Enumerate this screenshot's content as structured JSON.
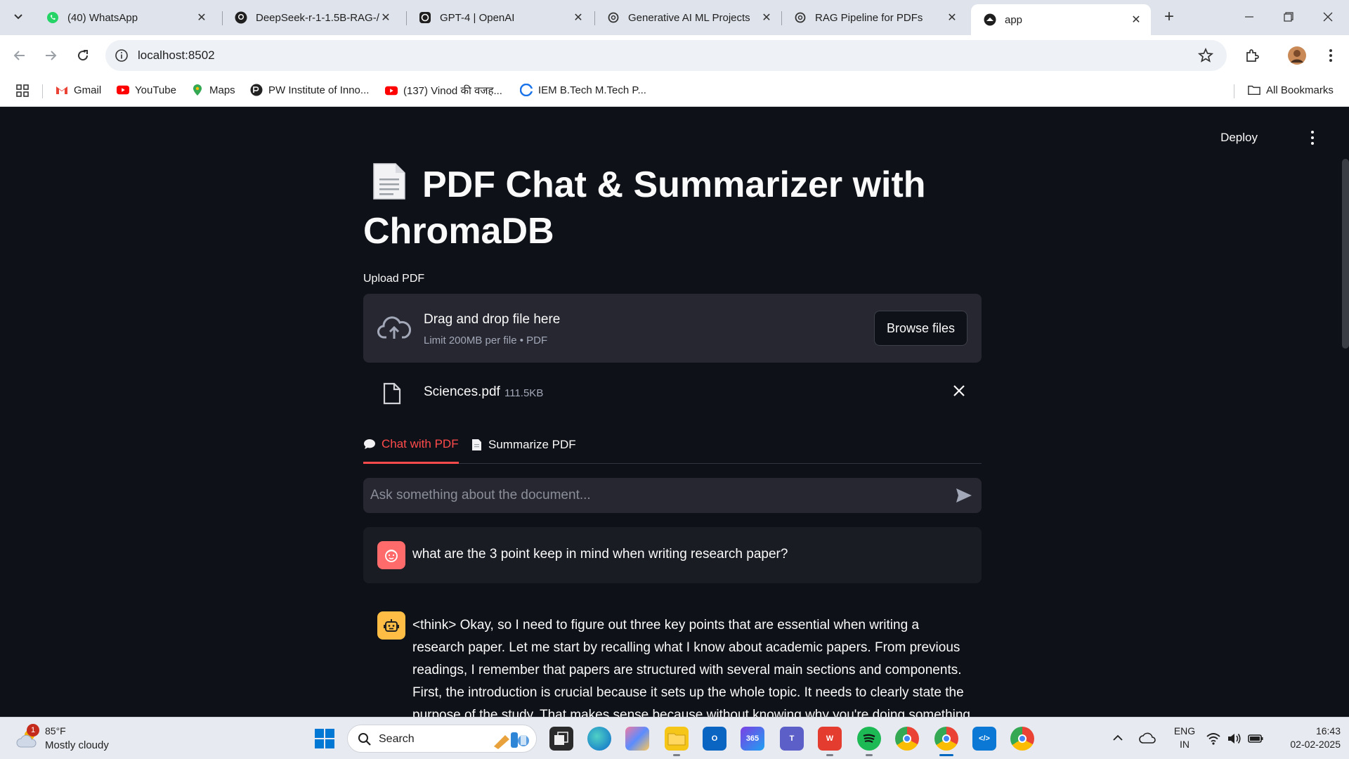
{
  "browser": {
    "tabs": [
      {
        "title": "(40) WhatsApp"
      },
      {
        "title": "DeepSeek-r-1-1.5B-RAG-/"
      },
      {
        "title": "GPT-4 | OpenAI"
      },
      {
        "title": "Generative AI ML Projects"
      },
      {
        "title": "RAG Pipeline for PDFs"
      },
      {
        "title": "app"
      }
    ],
    "url": "localhost:8502",
    "bookmarks": [
      {
        "label": "Gmail"
      },
      {
        "label": "YouTube"
      },
      {
        "label": "Maps"
      },
      {
        "label": "PW Institute of Inno..."
      },
      {
        "label": "(137) Vinod की वजह..."
      },
      {
        "label": "IEM B.Tech M.Tech P..."
      }
    ],
    "all_bookmarks": "All Bookmarks"
  },
  "app": {
    "deploy_label": "Deploy",
    "title": "PDF Chat & Summarizer with ChromaDB",
    "uploader": {
      "label": "Upload PDF",
      "drag_text": "Drag and drop file here",
      "limit_text": "Limit 200MB per file • PDF",
      "browse_label": "Browse files"
    },
    "uploaded_file": {
      "name": "Sciences.pdf",
      "size": "111.5KB"
    },
    "tabs": [
      {
        "label": "Chat with PDF",
        "active": true
      },
      {
        "label": "Summarize PDF",
        "active": false
      }
    ],
    "chat_input": {
      "placeholder": "Ask something about the document..."
    },
    "messages": {
      "user": "what are the 3 point keep in mind when writing research paper?",
      "assistant_p1": "<think> Okay, so I need to figure out three key points that are essential when writing a research paper. Let me start by recalling what I know about academic papers. From previous readings, I remember that papers are structured with several main sections and components.",
      "assistant_p2": "First, the introduction is crucial because it sets up the whole topic. It needs to clearly state the purpose of the study. That makes sense because without knowing why you're doing something,"
    }
  },
  "taskbar": {
    "weather_badge": "1",
    "temperature": "85°F",
    "condition": "Mostly cloudy",
    "search_label": "Search",
    "lang_line1": "ENG",
    "lang_line2": "IN",
    "time": "16:43",
    "date": "02-02-2025"
  },
  "colors": {
    "app_bg": "#0e1117",
    "accent": "#ff4b4b",
    "panel": "#262730",
    "user_avatar": "#ff6b6b",
    "bot_avatar": "#ffbd45"
  }
}
